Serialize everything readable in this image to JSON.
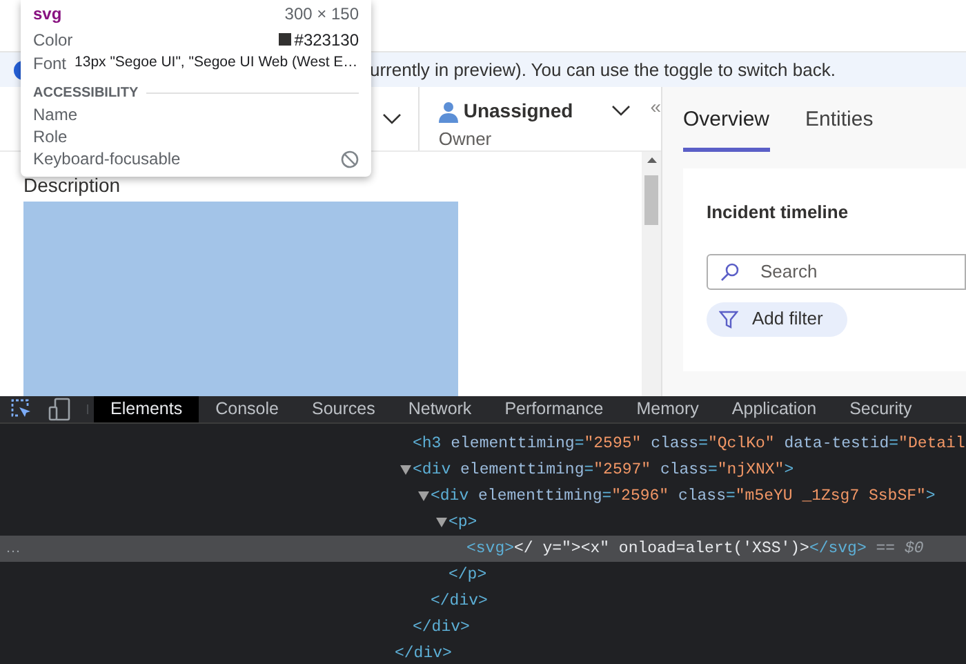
{
  "banner": {
    "text": "urrently in preview). You can use the toggle to switch back."
  },
  "tooltip": {
    "tag": "svg",
    "size": "300 × 150",
    "color_label": "Color",
    "color_value": "#323130",
    "color": "#323130",
    "font_label": "Font",
    "font_value": "13px \"Segoe UI\", \"Segoe UI Web (West E…",
    "section": "ACCESSIBILITY",
    "rows": [
      {
        "label": "Name"
      },
      {
        "label": "Role"
      },
      {
        "label": "Keyboard-focusable",
        "kind": "blocked"
      }
    ]
  },
  "header": {
    "owner_name": "Unassigned",
    "owner_label": "Owner",
    "collapse": "«"
  },
  "description": {
    "title": "Description"
  },
  "side_tabs": [
    {
      "label": "Overview",
      "selected": true
    },
    {
      "label": "Entities",
      "selected": false
    }
  ],
  "timeline": {
    "title": "Incident timeline",
    "search_placeholder": "Search",
    "filter_button": "Add filter"
  },
  "devtools": {
    "tabs": [
      {
        "label": "Elements",
        "selected": true
      },
      {
        "label": "Console",
        "selected": false
      },
      {
        "label": "Sources",
        "selected": false
      },
      {
        "label": "Network",
        "selected": false
      },
      {
        "label": "Performance",
        "selected": false
      },
      {
        "label": "Memory",
        "selected": false
      },
      {
        "label": "Application",
        "selected": false
      },
      {
        "label": "Security",
        "selected": false
      }
    ],
    "tree": {
      "closing": [
        {
          "kind": "tag",
          "text": "</div>"
        }
      ],
      "children": [
        {
          "segments": [
            {
              "kind": "tag",
              "text": "<h3"
            },
            {
              "kind": "attr",
              "text": " elementtiming"
            },
            {
              "kind": "tag",
              "text": "="
            },
            {
              "kind": "value",
              "text": "\"2595\""
            },
            {
              "kind": "attr",
              "text": " class"
            },
            {
              "kind": "tag",
              "text": "="
            },
            {
              "kind": "value",
              "text": "\"QclKo\""
            },
            {
              "kind": "attr",
              "text": " data-testid"
            },
            {
              "kind": "tag",
              "text": "="
            },
            {
              "kind": "value",
              "text": "\"Detail"
            }
          ],
          "expanded": false,
          "selected": false
        },
        {
          "segments": [
            {
              "kind": "tag",
              "text": "<div"
            },
            {
              "kind": "attr",
              "text": " elementtiming"
            },
            {
              "kind": "tag",
              "text": "="
            },
            {
              "kind": "value",
              "text": "\"2597\""
            },
            {
              "kind": "attr",
              "text": " class"
            },
            {
              "kind": "tag",
              "text": "="
            },
            {
              "kind": "value",
              "text": "\"njXNX\""
            },
            {
              "kind": "tag",
              "text": ">"
            }
          ],
          "expanded": true,
          "selected": false,
          "closing": [
            {
              "kind": "tag",
              "text": "</div>"
            }
          ],
          "children": [
            {
              "segments": [
                {
                  "kind": "tag",
                  "text": "<div"
                },
                {
                  "kind": "attr",
                  "text": " elementtiming"
                },
                {
                  "kind": "tag",
                  "text": "="
                },
                {
                  "kind": "value",
                  "text": "\"2596\""
                },
                {
                  "kind": "attr",
                  "text": " class"
                },
                {
                  "kind": "tag",
                  "text": "="
                },
                {
                  "kind": "value",
                  "text": "\"m5eYU _1Zsg7 SsbSF\""
                },
                {
                  "kind": "tag",
                  "text": ">"
                }
              ],
              "expanded": true,
              "selected": false,
              "closing": [
                {
                  "kind": "tag",
                  "text": "</div>"
                }
              ],
              "children": [
                {
                  "segments": [
                    {
                      "kind": "tag",
                      "text": "<p>"
                    }
                  ],
                  "expanded": true,
                  "selected": false,
                  "closing": [
                    {
                      "kind": "tag",
                      "text": "</p>"
                    }
                  ],
                  "children": [
                    {
                      "segments": [
                        {
                          "kind": "tag",
                          "text": "<svg>"
                        },
                        {
                          "kind": "text",
                          "text": "</ y=\"><x\" onload=alert('XSS')>"
                        },
                        {
                          "kind": "tag",
                          "text": "</svg>"
                        },
                        {
                          "kind": "ref",
                          "text": " == $0"
                        }
                      ],
                      "expanded": false,
                      "selected": true,
                      "dots": "…"
                    }
                  ]
                }
              ]
            }
          ]
        }
      ]
    }
  }
}
